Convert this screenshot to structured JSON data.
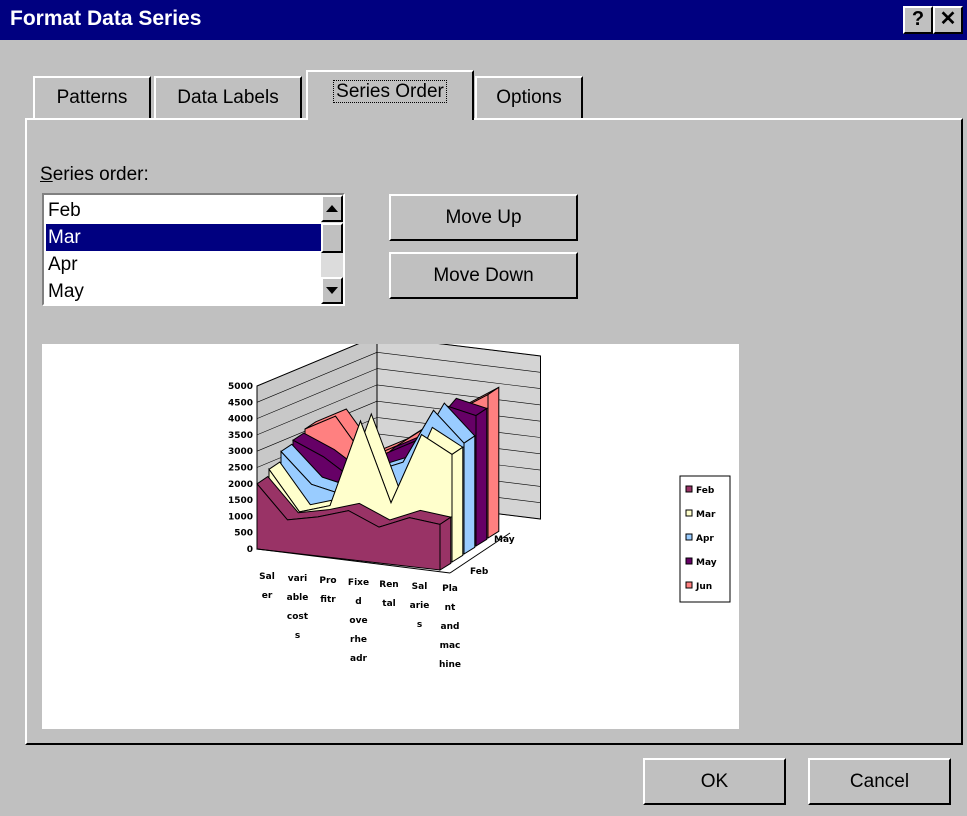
{
  "dialog": {
    "title": "Format Data Series",
    "help_label": "?",
    "close_label": "✕"
  },
  "tabs": [
    {
      "label": "Patterns"
    },
    {
      "label": "Data Labels"
    },
    {
      "label": "Series Order"
    },
    {
      "label": "Options"
    }
  ],
  "series_order": {
    "label": "Series order:",
    "items": [
      "Feb",
      "Mar",
      "Apr",
      "May"
    ],
    "selected": "Mar",
    "move_up_label": "Move Up",
    "move_down_label": "Move Down"
  },
  "footer": {
    "ok_label": "OK",
    "cancel_label": "Cancel"
  },
  "chart_data": {
    "type": "area",
    "title": "",
    "categories": [
      "Salaer",
      "variable costs",
      "Profitr",
      "Fixed overheadr",
      "Rental",
      "Salaries",
      "Plant and machine"
    ],
    "category_labels": [
      [
        "Sal",
        "er"
      ],
      [
        "vari",
        "able",
        "cost",
        "s"
      ],
      [
        "Pro",
        "fitr"
      ],
      [
        "Fixe",
        "d",
        "ove",
        "rhe",
        "adr"
      ],
      [
        "Ren",
        "tal"
      ],
      [
        "Sal",
        "arie",
        "s"
      ],
      [
        "Pla",
        "nt",
        "and",
        "mac",
        "hine"
      ]
    ],
    "ylim": [
      0,
      5000
    ],
    "yticks": [
      "0",
      "500",
      "1000",
      "1500",
      "2000",
      "2500",
      "3000",
      "3500",
      "4000",
      "4500",
      "5000"
    ],
    "depth_labels": [
      "Feb",
      "May"
    ],
    "legend": [
      "Feb",
      "Mar",
      "Apr",
      "May",
      "Jun"
    ],
    "legend_position": "right",
    "series": [
      {
        "name": "Feb",
        "color": "#993366",
        "values": [
          2000,
          1000,
          1200,
          1500,
          1100,
          1500,
          1400
        ]
      },
      {
        "name": "Mar",
        "color": "#ffffcc",
        "values": [
          2200,
          1000,
          1300,
          4000,
          1600,
          3800,
          3300
        ]
      },
      {
        "name": "Apr",
        "color": "#99ccff",
        "values": [
          2500,
          1600,
          1400,
          2200,
          2600,
          4300,
          3400
        ]
      },
      {
        "name": "May",
        "color": "#660066",
        "values": [
          2600,
          2200,
          1600,
          2500,
          3000,
          4200,
          4000
        ]
      },
      {
        "name": "Jun",
        "color": "#ff8080",
        "values": [
          2700,
          3200,
          2000,
          2500,
          3200,
          3800,
          4400
        ]
      }
    ]
  }
}
